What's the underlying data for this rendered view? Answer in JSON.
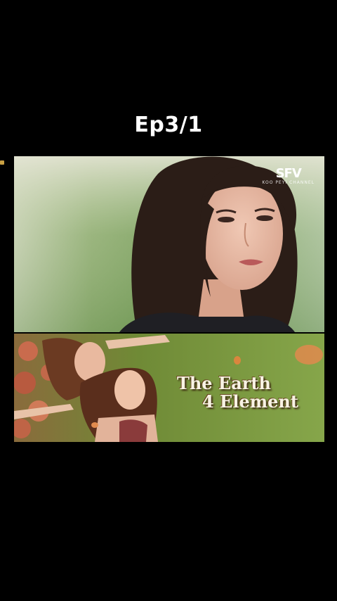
{
  "episode": {
    "title": "Ep3/1"
  },
  "watermark": {
    "mark": "SFV",
    "sub": "KOO PEYI CHANNEL"
  },
  "poster": {
    "title_line1": "The Earth",
    "title_line2": "4 Element"
  },
  "colors": {
    "background": "#000000",
    "title_text": "#ffffff",
    "poster_grass": "#7a9a3a"
  }
}
